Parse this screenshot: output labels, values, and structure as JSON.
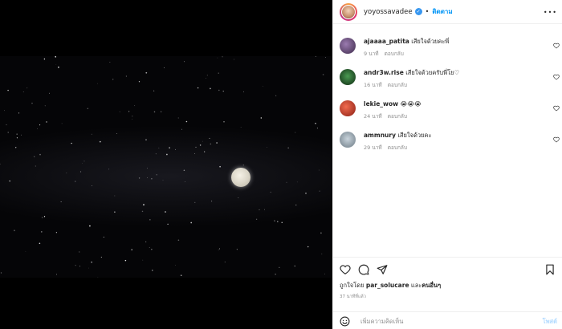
{
  "header": {
    "username": "yoyossavadee",
    "separator": "•",
    "follow_label": "ติดตาม",
    "more": "•••"
  },
  "comments": [
    {
      "username": "ajaaaa_patita",
      "text": "เสียใจด้วยคะพี่",
      "time": "9 นาที",
      "reply": "ตอบกลับ"
    },
    {
      "username": "andr3w.rise",
      "text": "เสียใจด้วยครับพี่โย♡",
      "time": "16 นาที",
      "reply": "ตอบกลับ"
    },
    {
      "username": "lekie_wow",
      "text": "😭😭😭",
      "time": "24 นาที",
      "reply": "ตอบกลับ"
    },
    {
      "username": "ammnury",
      "text": "เสียใจด้วยคะ",
      "time": "29 นาที",
      "reply": "ตอบกลับ"
    }
  ],
  "likes": {
    "prefix": "ถูกใจโดย",
    "user": "par_solucare",
    "and": "และ",
    "others": "คนอื่นๆ"
  },
  "post_time": "37 นาทีที่แล้ว",
  "comment_box": {
    "placeholder": "เพิ่มความคิดเห็น",
    "post_label": "โพสต์"
  },
  "colors": {
    "accent": "#0095f6",
    "post_disabled": "#b3dbff",
    "photo_bg": "#000000"
  }
}
